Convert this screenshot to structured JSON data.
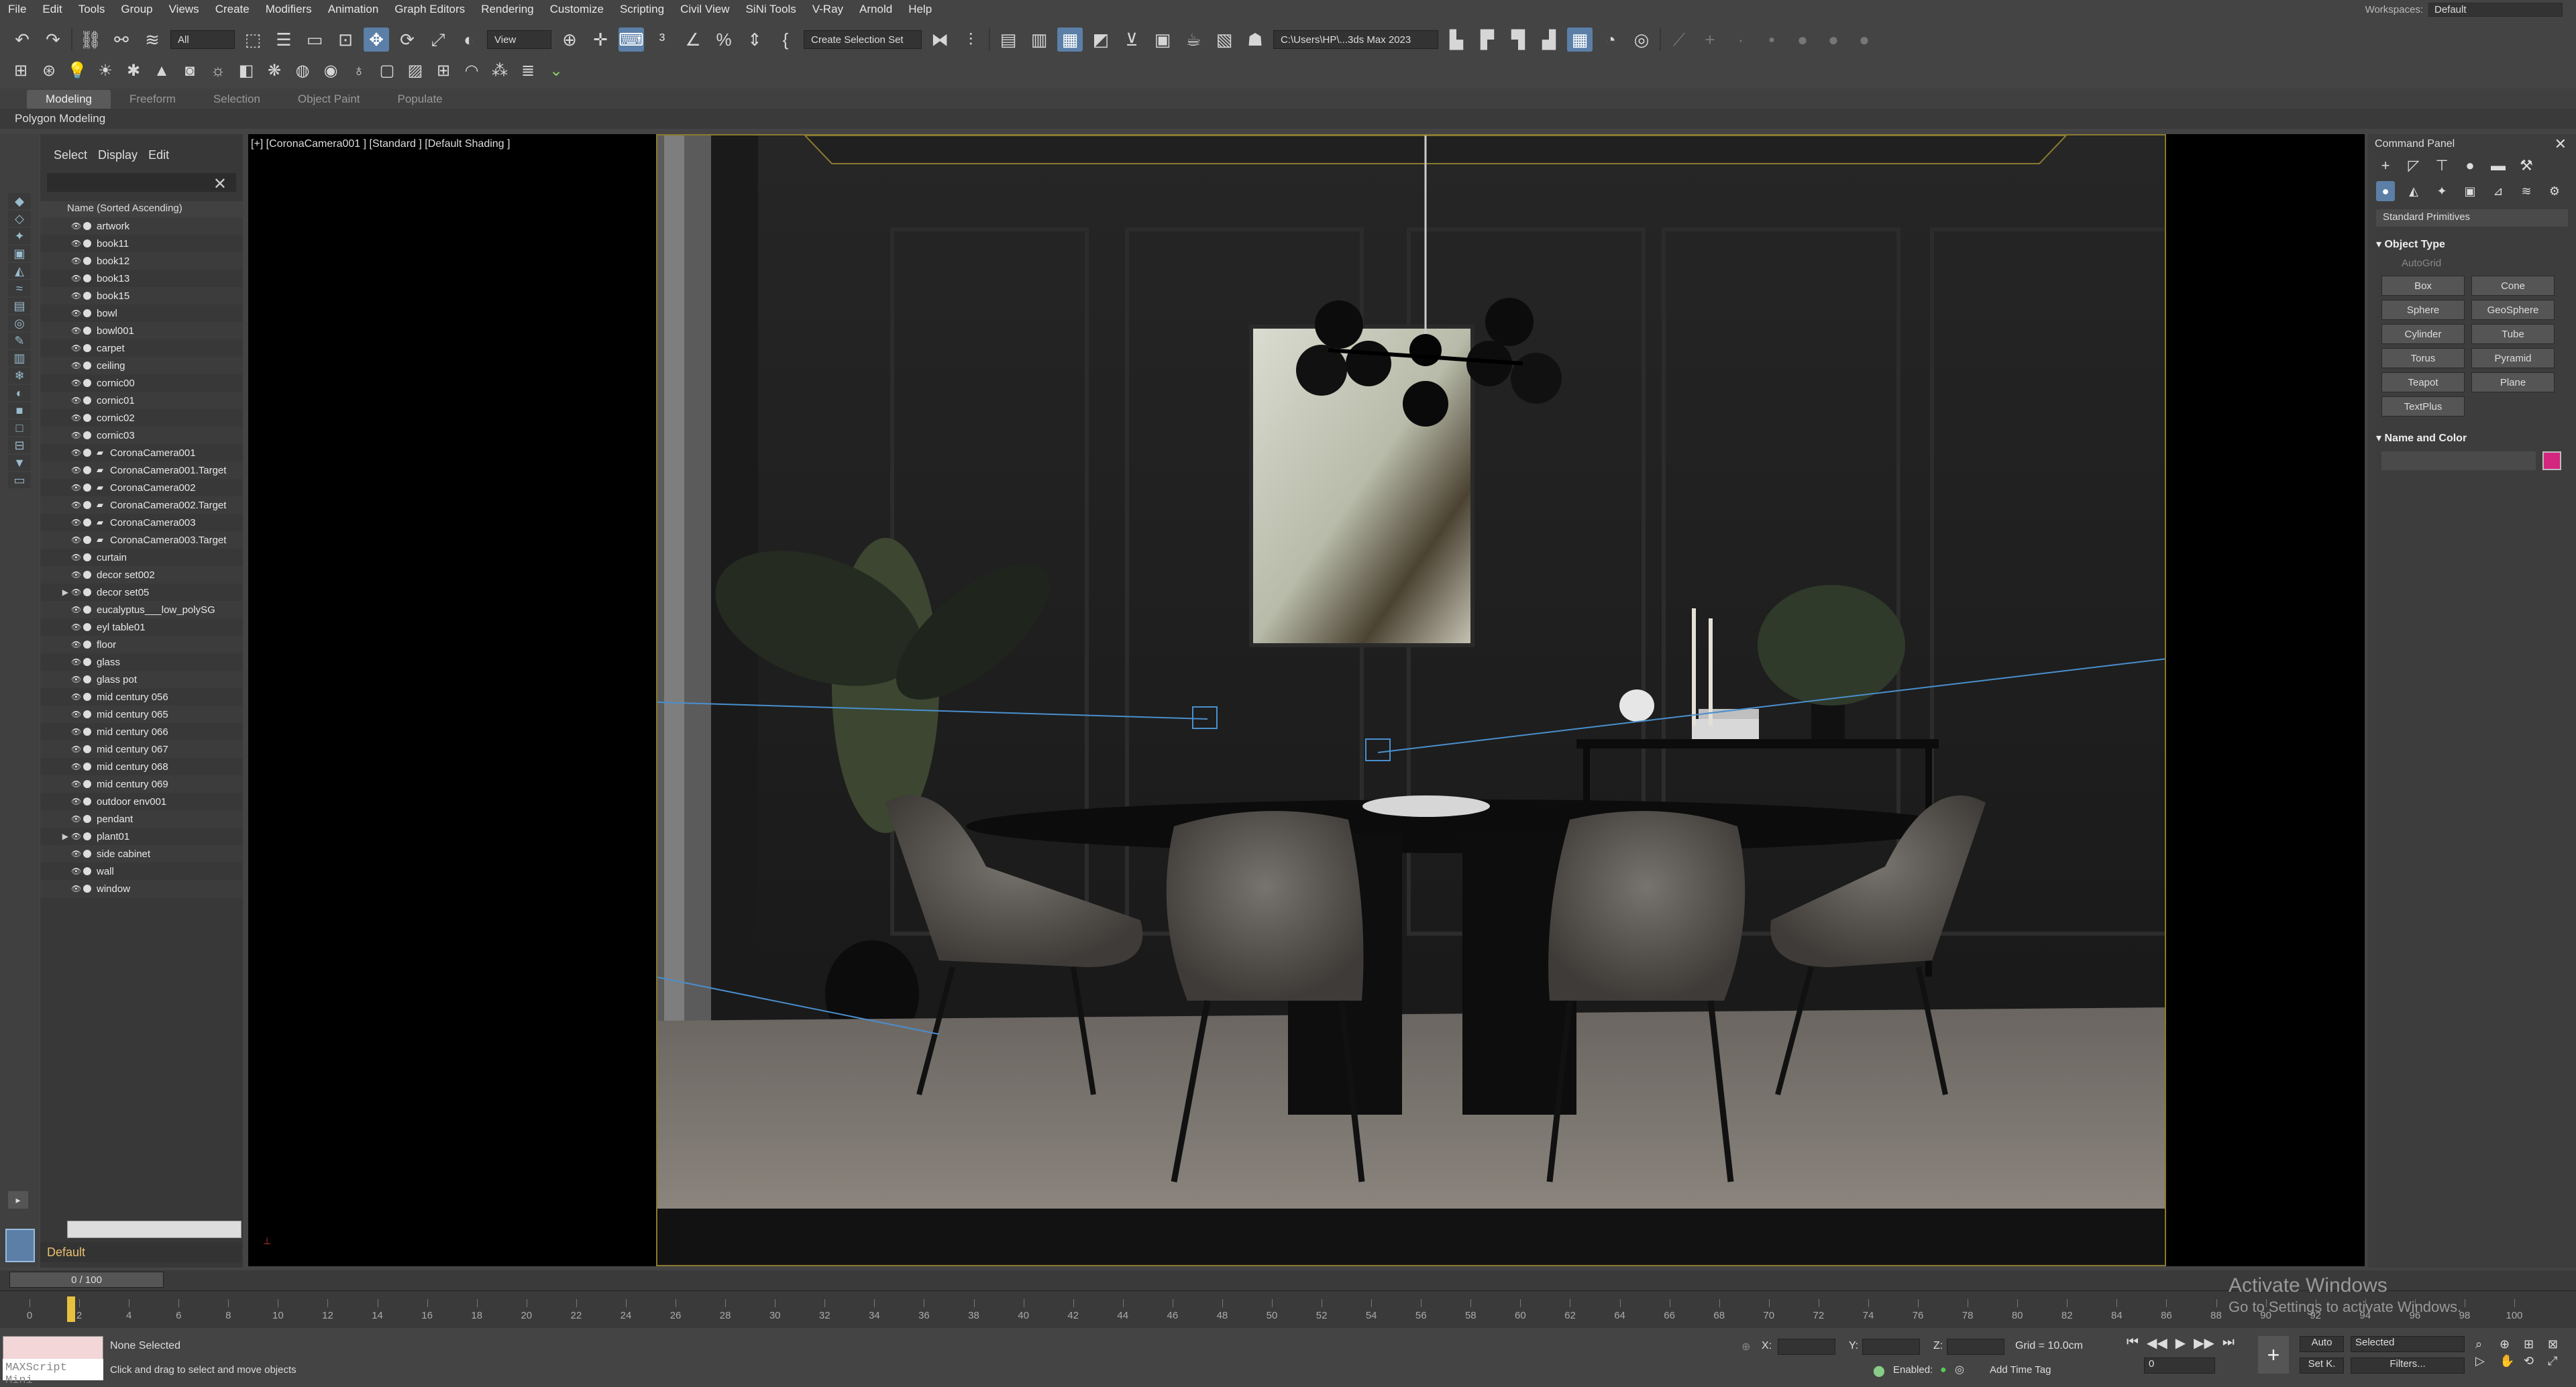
{
  "menu": [
    "File",
    "Edit",
    "Tools",
    "Group",
    "Views",
    "Create",
    "Modifiers",
    "Animation",
    "Graph Editors",
    "Rendering",
    "Customize",
    "Scripting",
    "Civil View",
    "SiNi Tools",
    "V-Ray",
    "Arnold",
    "Help"
  ],
  "workspace": {
    "label": "Workspaces:",
    "value": "Default"
  },
  "toolbar": {
    "selection_filter": "All",
    "ref_coord": "View",
    "create_selection_set": "Create Selection Set",
    "project_path": "C:\\Users\\HP\\...3ds Max 2023"
  },
  "ribbon": {
    "tabs": [
      "Modeling",
      "Freeform",
      "Selection",
      "Object Paint",
      "Populate"
    ],
    "active": "Modeling",
    "sub": "Polygon Modeling"
  },
  "explorer": {
    "menu": [
      "Select",
      "Display",
      "Edit"
    ],
    "column_header": "Name (Sorted Ascending)",
    "items": [
      "artwork",
      "book11",
      "book12",
      "book13",
      "book15",
      "bowl",
      "bowl001",
      "carpet",
      "ceiling",
      "cornic00",
      "cornic01",
      "cornic02",
      "cornic03",
      "CoronaCamera001",
      "CoronaCamera001.Target",
      "CoronaCamera002",
      "CoronaCamera002.Target",
      "CoronaCamera003",
      "CoronaCamera003.Target",
      "curtain",
      "decor set002",
      "decor set05",
      "eucalyptus___low_polySG",
      "eyl table01",
      "floor",
      "glass",
      "glass pot",
      "mid century 056",
      "mid century 065",
      "mid century 066",
      "mid century 067",
      "mid century 068",
      "mid century 069",
      "outdoor env001",
      "pendant",
      "plant01",
      "side cabinet",
      "wall",
      "window"
    ],
    "layer": "Default"
  },
  "viewport": {
    "label": "[+] [CoronaCamera001 ] [Standard ] [Default Shading ]"
  },
  "command_panel": {
    "title": "Command Panel",
    "category": "Standard Primitives",
    "object_type_title": "Object Type",
    "autogrid": "AutoGrid",
    "buttons": [
      "Box",
      "Cone",
      "Sphere",
      "GeoSphere",
      "Cylinder",
      "Tube",
      "Torus",
      "Pyramid",
      "Teapot",
      "Plane",
      "TextPlus"
    ],
    "name_color_title": "Name and Color",
    "object_color": "#d4257f"
  },
  "timeline": {
    "frame": "0 / 100",
    "ticks": [
      "0",
      "2",
      "4",
      "6",
      "8",
      "10",
      "12",
      "14",
      "16",
      "18",
      "20",
      "22",
      "24",
      "26",
      "28",
      "30",
      "32",
      "34",
      "36",
      "38",
      "40",
      "42",
      "44",
      "46",
      "48",
      "50",
      "52",
      "54",
      "56",
      "58",
      "60",
      "62",
      "64",
      "66",
      "68",
      "70",
      "72",
      "74",
      "76",
      "78",
      "80",
      "82",
      "84",
      "86",
      "88",
      "90",
      "92",
      "94",
      "96",
      "98",
      "100"
    ]
  },
  "status": {
    "maxscript": "MAXScript Mini",
    "selection": "None Selected",
    "prompt": "Click and drag to select and move objects",
    "x_label": "X:",
    "y_label": "Y:",
    "z_label": "Z:",
    "grid": "Grid = 10.0cm",
    "enabled": "Enabled:",
    "add_time_tag": "Add Time Tag",
    "auto": "Auto",
    "set_key": "Set K.",
    "key_mode": "Selected",
    "filters": "Filters...",
    "frame_value": "0"
  },
  "watermark": {
    "line1": "Activate Windows",
    "line2": "Go to Settings to activate Windows."
  }
}
